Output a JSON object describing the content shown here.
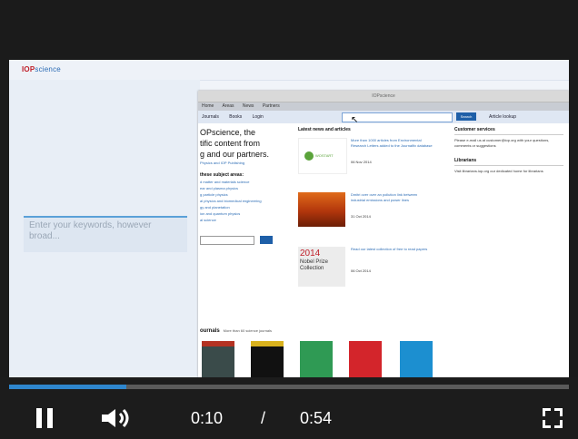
{
  "video": {
    "logo_iop": "IOP",
    "logo_science": "science",
    "search_placeholder": "Enter your keywords, however broad...",
    "browser": {
      "window_title": "IOPscience",
      "menu": [
        "Home",
        "Areas",
        "News",
        "Partners"
      ],
      "nav": [
        "Journals",
        "Books",
        "Login"
      ],
      "search_button": "Search",
      "article_lookup": "Article lookup",
      "hero_lines": [
        "OPscience, the",
        "tific content from",
        "g and our partners."
      ],
      "hero_sub": "Physics and IOP Publishing",
      "browse_heading": "these subject areas:",
      "subject_areas": [
        "d matter and materials science",
        "ear and plasma physics",
        "g particle physics",
        "al physics and biomedical engineering",
        "gy and planetation",
        "ion and quantum physics",
        "al science"
      ],
      "news_heading": "Latest news and articles",
      "news": [
        {
          "title": "More than 1000 articles from Environmental Research Letters added to the Journalfix database",
          "date": "06 Nov 2014",
          "thumb_label": "WOSTART"
        },
        {
          "title": "Dmitri over over an pollution link between industrial emissions and power lines",
          "date": "31 Oct 2014",
          "thumb_label": ""
        },
        {
          "title": "Read our latest collection of free to read papers",
          "date": "06 Oct 2014",
          "thumb_year": "2014",
          "thumb_text": "Nobel Prize Collection"
        }
      ],
      "customer_heading": "Customer services",
      "customer_text": "Please e-mail us at customer@iop.org with your questions, comments or suggestions",
      "librarians_heading": "Librarians",
      "librarians_text": "Visit librarians.iop.org our dedicated home for librarians",
      "journals_heading": "ournals",
      "journals_more": "More than 60 science journals"
    }
  },
  "controls": {
    "progress_fraction": 0.21,
    "current_time": "0:10",
    "separator": "/",
    "duration": "0:54",
    "play_icon": "pause-icon",
    "volume_icon": "volume-icon",
    "fullscreen_icon": "fullscreen-icon",
    "accent_color": "#2e86cd"
  }
}
